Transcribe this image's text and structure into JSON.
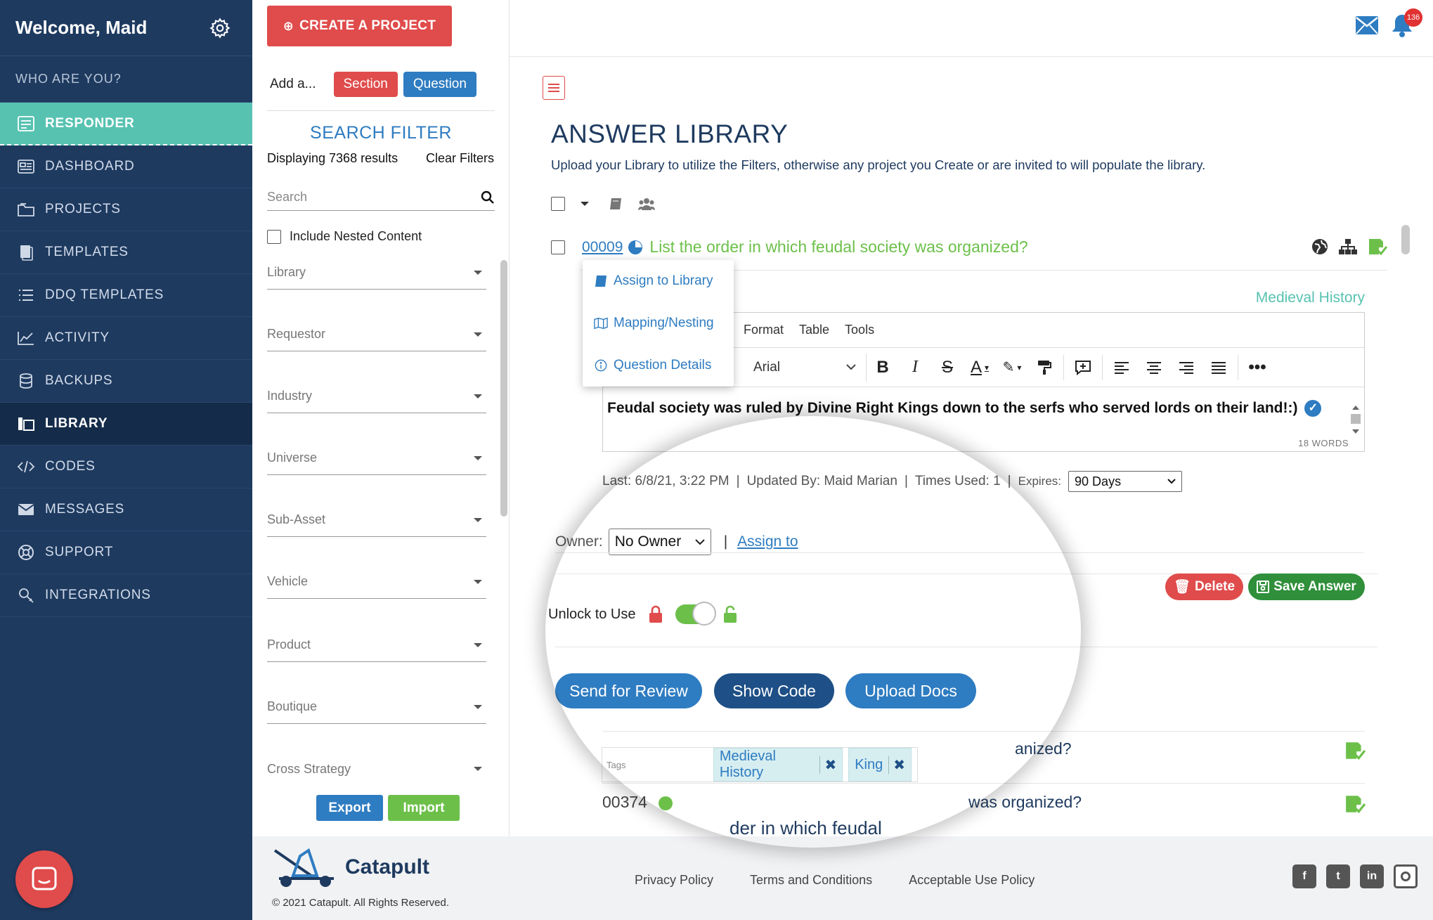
{
  "sidebar": {
    "welcome": "Welcome, Maid",
    "who": "WHO ARE YOU?",
    "items": [
      {
        "label": "RESPONDER"
      },
      {
        "label": "DASHBOARD"
      },
      {
        "label": "PROJECTS"
      },
      {
        "label": "TEMPLATES"
      },
      {
        "label": "DDQ TEMPLATES"
      },
      {
        "label": "ACTIVITY"
      },
      {
        "label": "BACKUPS"
      },
      {
        "label": "LIBRARY"
      },
      {
        "label": "CODES"
      },
      {
        "label": "MESSAGES"
      },
      {
        "label": "SUPPORT"
      },
      {
        "label": "INTEGRATIONS"
      }
    ]
  },
  "topbar": {
    "create_label": "CREATE A PROJECT",
    "notifications_count": "136"
  },
  "filter": {
    "add_label": "Add a...",
    "section_label": "Section",
    "question_label": "Question",
    "title": "SEARCH FILTER",
    "count": "Displaying 7368 results",
    "clear": "Clear Filters",
    "search_placeholder": "Search",
    "nested_label": "Include Nested Content",
    "dropdowns": [
      "Library",
      "Requestor",
      "Industry",
      "Universe",
      "Sub-Asset",
      "Vehicle",
      "Product",
      "Boutique",
      "Cross Strategy"
    ],
    "export_label": "Export",
    "import_label": "Import"
  },
  "main": {
    "title": "ANSWER LIBRARY",
    "subtitle": "Upload your Library to utilize the Filters, otherwise any project you Create or are invited to will populate the library.",
    "question": {
      "id": "00009",
      "text": "List the order in which feudal society was organized?",
      "tag_label": "Medieval History"
    },
    "popup": [
      "Assign to Library",
      "Mapping/Nesting",
      "Question Details"
    ],
    "editor": {
      "menu": [
        "Format",
        "Table",
        "Tools"
      ],
      "font": "Arial",
      "content": "Feudal society was ruled by Divine Right Kings down to the serfs who served lords on their land!:)",
      "words": "18 WORDS"
    },
    "meta": {
      "last": "Last: 6/8/21, 3:22 PM",
      "updated": "Updated By: Maid Marian",
      "times": "Times Used: 1",
      "expires_label": "Expires:",
      "expires_value": "90 Days"
    },
    "owner": {
      "label": "Owner:",
      "value": "No Owner",
      "assign": "Assign to"
    },
    "delete_label": "Delete",
    "save_label": "Save Answer",
    "unlock_label": "Unlock to Use",
    "actions": {
      "send": "Send for Review",
      "code": "Show Code",
      "upload": "Upload Docs"
    },
    "tags": {
      "placeholder": "Tags",
      "chips": [
        "Medieval History",
        "King"
      ]
    },
    "q2_text": "anized?",
    "q3_id": "00374",
    "q3_text": "was organized?",
    "q3_fragment": "der in which feudal"
  },
  "footer": {
    "brand": "Catapult",
    "copyright": "© 2021 Catapult. All Rights Reserved.",
    "links": [
      "Privacy Policy",
      "Terms and Conditions",
      "Acceptable Use Policy"
    ],
    "social": [
      "facebook-icon",
      "twitter-icon",
      "linkedin-icon",
      "instagram-icon"
    ]
  },
  "colors": {
    "sidebar": "#1e3a5f",
    "responder": "#58c2b1",
    "accent_red": "#e04b4b",
    "accent_blue": "#2e7cc1",
    "accent_green": "#6cc04a"
  }
}
